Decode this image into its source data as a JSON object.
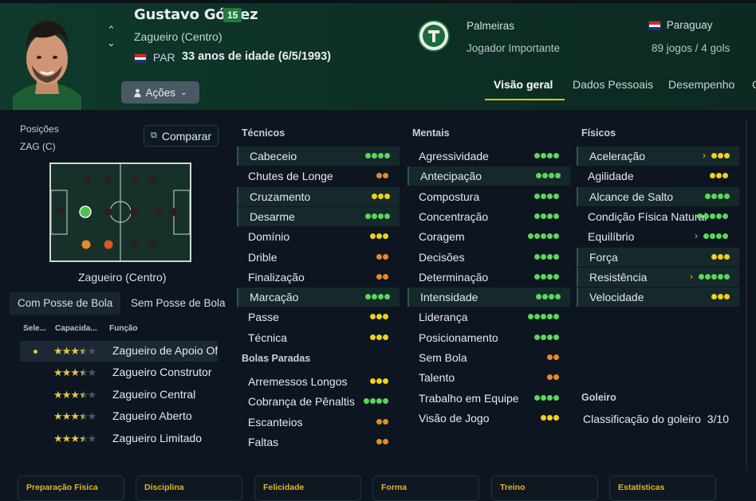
{
  "player": {
    "name": "Gustavo Gómez",
    "number": "15",
    "position": "Zagueiro (Centro)",
    "nationality_code": "PAR",
    "age_text": "33 anos de idade (6/5/1993)",
    "actions_label": "Ações"
  },
  "club": {
    "name": "Palmeiras",
    "role": "Jogador Importante"
  },
  "country": {
    "name": "Paraguay",
    "caps": "89 jogos / 4 gols"
  },
  "tabs": [
    "Visão geral",
    "Dados Pessoais",
    "Desempenho",
    "C"
  ],
  "positions": {
    "label": "Posições",
    "value": "ZAG (C)",
    "compare_label": "Comparar",
    "pitch_label": "Zagueiro (Centro)"
  },
  "subtabs": [
    "Com Posse de Bola",
    "Sem Posse de Bola"
  ],
  "roles_header": {
    "select": "Sele...",
    "capacity": "Capacida...",
    "function": "Função"
  },
  "roles": [
    {
      "name": "Zagueiro de Apoio Ofensivo",
      "stars": 3.5,
      "selected": true
    },
    {
      "name": "Zagueiro Construtor",
      "stars": 3.5,
      "selected": false
    },
    {
      "name": "Zagueiro Central",
      "stars": 3.5,
      "selected": false
    },
    {
      "name": "Zagueiro Aberto",
      "stars": 3.5,
      "selected": false
    },
    {
      "name": "Zagueiro Limitado",
      "stars": 3.5,
      "selected": false
    }
  ],
  "colors": {
    "green": "#5cd65c",
    "yellow": "#f0d020",
    "orange": "#e88a2a",
    "accent": "#e0c020"
  },
  "technical": {
    "title": "Técnicos",
    "items": [
      {
        "name": "Cabeceio",
        "level": "4g",
        "hl": true
      },
      {
        "name": "Chutes de Longe",
        "level": "2o",
        "hl": false
      },
      {
        "name": "Cruzamento",
        "level": "3y",
        "hl": true
      },
      {
        "name": "Desarme",
        "level": "4g",
        "hl": true
      },
      {
        "name": "Domínio",
        "level": "3y",
        "hl": false
      },
      {
        "name": "Drible",
        "level": "2o",
        "hl": false
      },
      {
        "name": "Finalização",
        "level": "2o",
        "hl": false
      },
      {
        "name": "Marcação",
        "level": "4g",
        "hl": true
      },
      {
        "name": "Passe",
        "level": "3y",
        "hl": false
      },
      {
        "name": "Técnica",
        "level": "3y",
        "hl": false
      }
    ]
  },
  "set_pieces": {
    "title": "Bolas Paradas",
    "items": [
      {
        "name": "Arremessos Longos",
        "level": "3y",
        "hl": false
      },
      {
        "name": "Cobrança de Pênaltis",
        "level": "4g",
        "hl": false
      },
      {
        "name": "Escanteios",
        "level": "2o",
        "hl": false
      },
      {
        "name": "Faltas",
        "level": "2o",
        "hl": false
      }
    ]
  },
  "mental": {
    "title": "Mentais",
    "items": [
      {
        "name": "Agressividade",
        "level": "4g",
        "hl": false
      },
      {
        "name": "Antecipação",
        "level": "4g",
        "hl": true
      },
      {
        "name": "Compostura",
        "level": "4g",
        "hl": false
      },
      {
        "name": "Concentração",
        "level": "4g",
        "hl": false
      },
      {
        "name": "Coragem",
        "level": "5g",
        "hl": false
      },
      {
        "name": "Decisões",
        "level": "4g",
        "hl": false
      },
      {
        "name": "Determinação",
        "level": "4g",
        "hl": false
      },
      {
        "name": "Intensidade",
        "level": "4g",
        "hl": true
      },
      {
        "name": "Liderança",
        "level": "5g",
        "hl": false
      },
      {
        "name": "Posicionamento",
        "level": "4g",
        "hl": false
      },
      {
        "name": "Sem Bola",
        "level": "2o",
        "hl": false
      },
      {
        "name": "Talento",
        "level": "2o",
        "hl": false
      },
      {
        "name": "Trabalho em Equipe",
        "level": "4g",
        "hl": false
      },
      {
        "name": "Visão de Jogo",
        "level": "3y",
        "hl": false
      }
    ]
  },
  "physical": {
    "title": "Físicos",
    "items": [
      {
        "name": "Aceleração",
        "level": "3y",
        "hl": true,
        "arrow": true
      },
      {
        "name": "Agilidade",
        "level": "3y",
        "hl": false
      },
      {
        "name": "Alcance de Salto",
        "level": "4g",
        "hl": true
      },
      {
        "name": "Condição Física Natural",
        "level": "5g",
        "hl": false
      },
      {
        "name": "Equilíbrio",
        "level": "4g",
        "hl": false,
        "arrow": true
      },
      {
        "name": "Força",
        "level": "3y",
        "hl": true
      },
      {
        "name": "Resistência",
        "level": "5g",
        "hl": true,
        "arrow": true
      },
      {
        "name": "Velocidade",
        "level": "3y",
        "hl": true
      }
    ]
  },
  "goalkeeper": {
    "title": "Goleiro",
    "label": "Classificação do goleiro",
    "value": "3/10"
  },
  "bottom_cards": [
    "Preparação Física",
    "Disciplina",
    "Felicidade",
    "Forma",
    "Treino",
    "Estatísticas"
  ]
}
